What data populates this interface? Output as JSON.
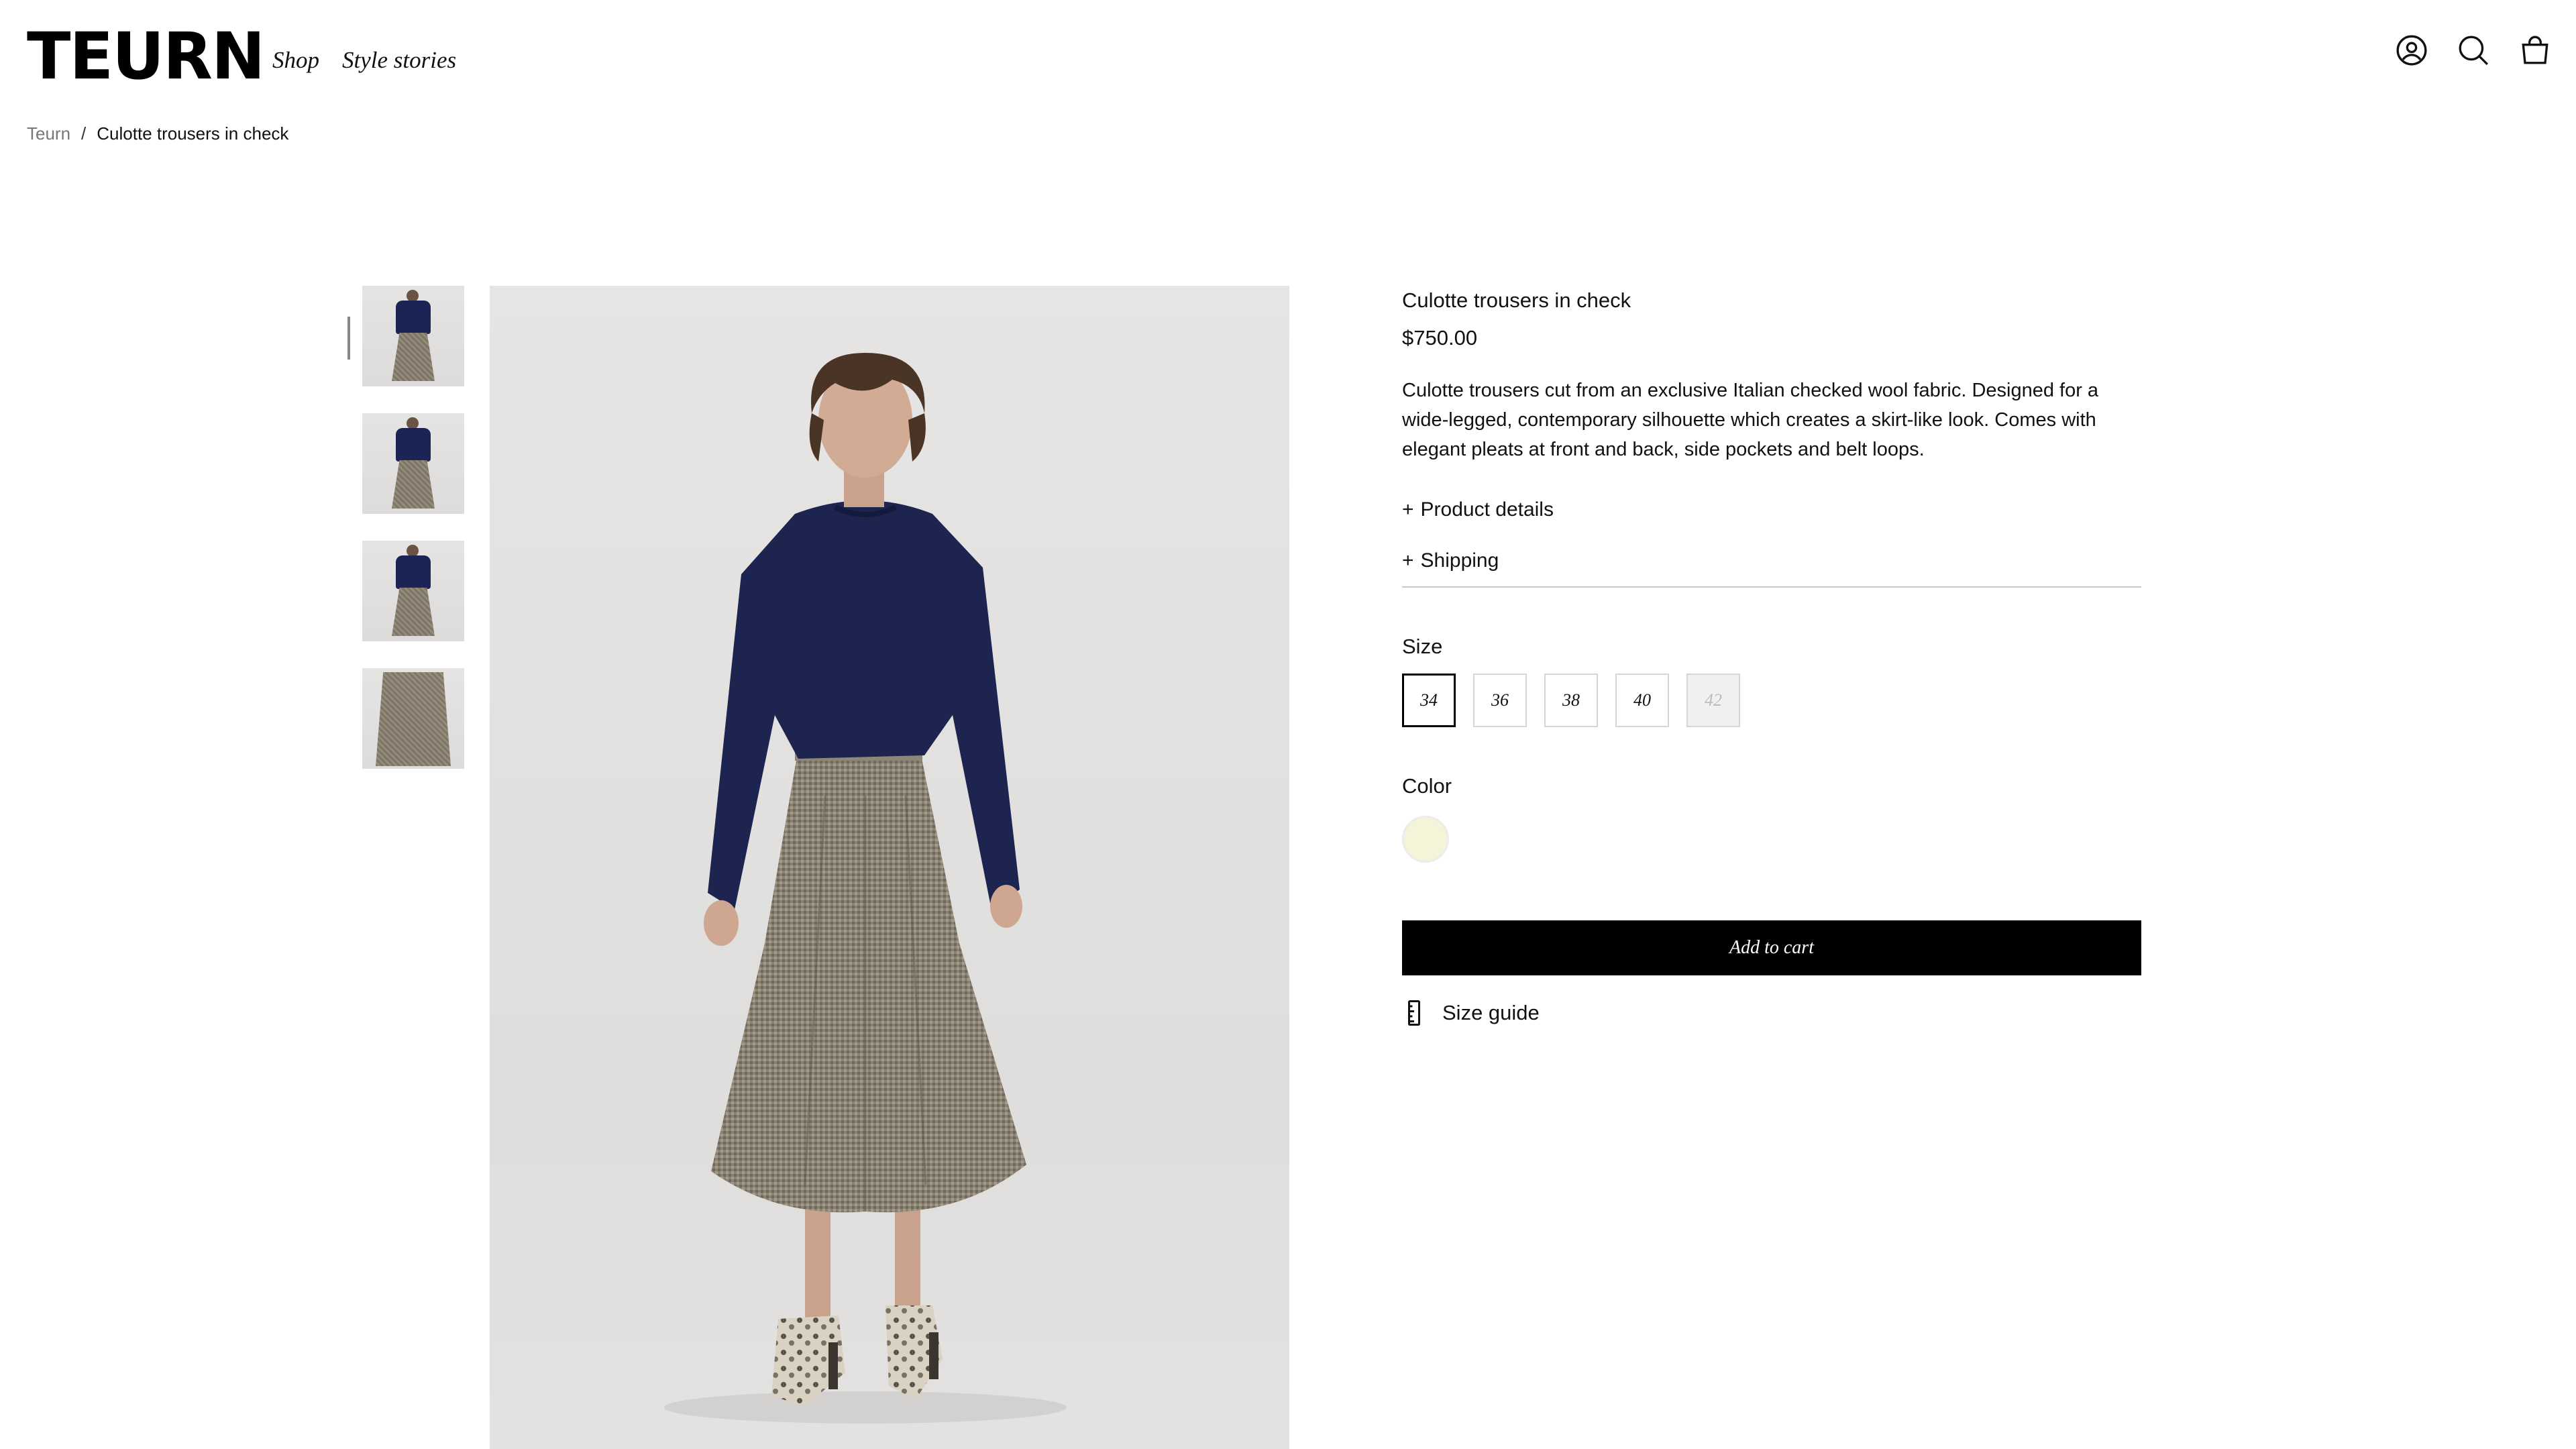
{
  "header": {
    "logo": "TEURN",
    "nav": [
      "Shop",
      "Style stories"
    ],
    "icons": [
      "account-icon",
      "search-icon",
      "cart-icon"
    ]
  },
  "breadcrumb": {
    "home": "Teurn",
    "separator": "/",
    "current": "Culotte trousers in check"
  },
  "gallery": {
    "thumbnail_count": 4,
    "selected_index": 0
  },
  "product": {
    "title": "Culotte trousers in check",
    "price": "$750.00",
    "description": "Culotte trousers cut from an exclusive Italian checked wool fabric. Designed for a wide-legged, contemporary silhouette which creates a skirt-like look. Comes with elegant pleats at front and back, side pockets and belt loops.",
    "accordion": [
      {
        "sign": "+",
        "label": "Product details"
      },
      {
        "sign": "+",
        "label": "Shipping"
      }
    ],
    "size_label": "Size",
    "sizes": [
      {
        "label": "34",
        "state": "selected"
      },
      {
        "label": "36",
        "state": "available"
      },
      {
        "label": "38",
        "state": "available"
      },
      {
        "label": "40",
        "state": "available"
      },
      {
        "label": "42",
        "state": "unavailable"
      }
    ],
    "color_label": "Color",
    "color_swatch": "#f4f4d9",
    "add_to_cart": "Add to cart",
    "size_guide": "Size guide"
  }
}
